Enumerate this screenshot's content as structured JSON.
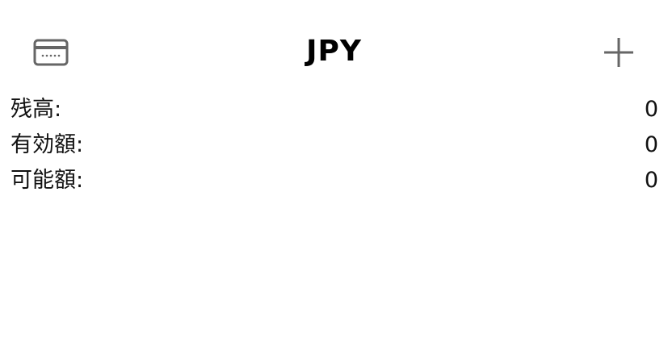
{
  "header": {
    "title": "JPY",
    "left_icon": "credit-card-icon",
    "right_icon": "plus-icon"
  },
  "balances": [
    {
      "label": "残高:",
      "value": "0"
    },
    {
      "label": "有効額:",
      "value": "0"
    },
    {
      "label": "可能額:",
      "value": "0"
    }
  ],
  "colors": {
    "icon": "#666666",
    "text": "#111111",
    "background": "#ffffff"
  }
}
